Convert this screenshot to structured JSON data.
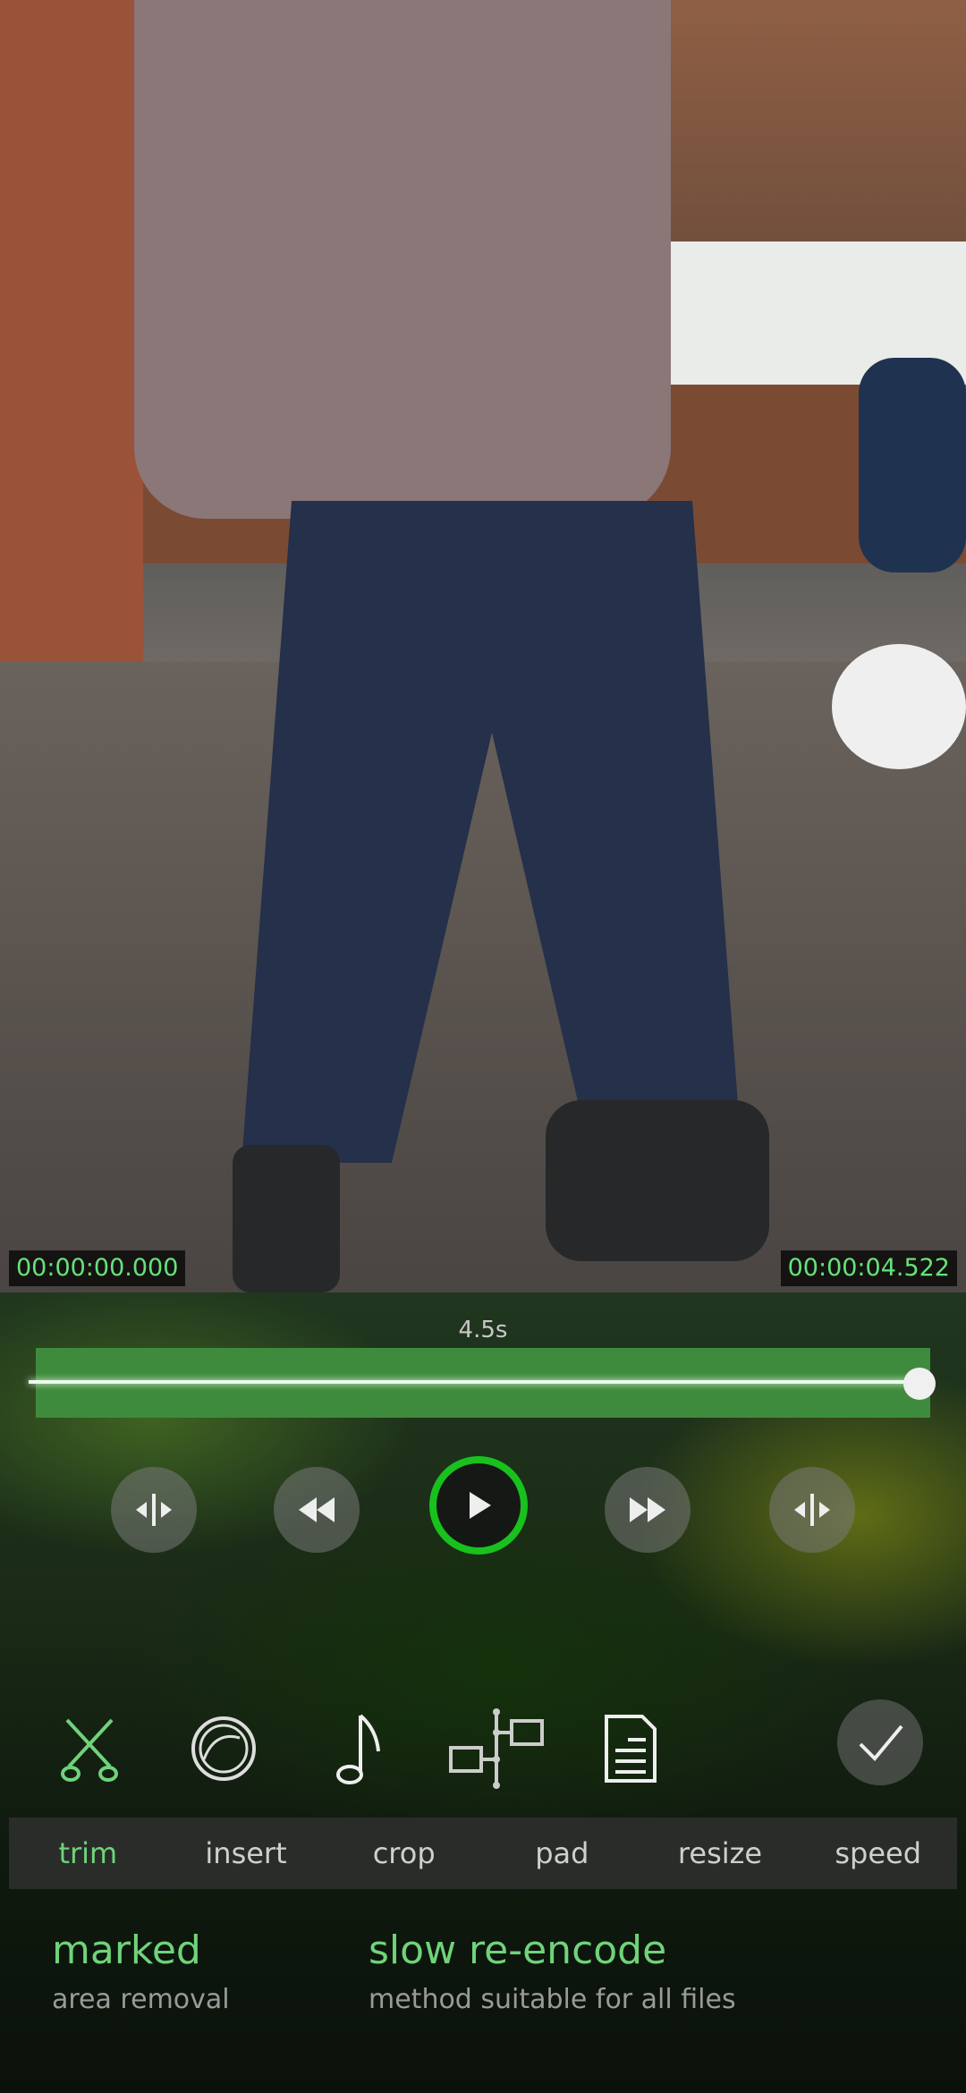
{
  "video": {
    "start_time": "00:00:00.000",
    "end_time": "00:00:04.522"
  },
  "timeline": {
    "duration": "4.5s",
    "position_fraction": 1.0
  },
  "playback_controls": [
    {
      "name": "split-left",
      "icon": "split-icon"
    },
    {
      "name": "rewind",
      "icon": "rewind-icon"
    },
    {
      "name": "play",
      "icon": "play-icon"
    },
    {
      "name": "fast-forward",
      "icon": "fast-forward-icon"
    },
    {
      "name": "split-right",
      "icon": "split-icon"
    }
  ],
  "tools": [
    {
      "name": "trim",
      "icon": "scissors-icon",
      "active": true
    },
    {
      "name": "filter",
      "icon": "filter-icon"
    },
    {
      "name": "audio",
      "icon": "music-note-icon"
    },
    {
      "name": "transition",
      "icon": "split-frames-icon"
    },
    {
      "name": "document",
      "icon": "document-icon"
    }
  ],
  "tabs": [
    {
      "label": "trim",
      "active": true
    },
    {
      "label": "insert"
    },
    {
      "label": "crop"
    },
    {
      "label": "pad"
    },
    {
      "label": "resize"
    },
    {
      "label": "speed"
    }
  ],
  "info": {
    "mode_title": "marked",
    "mode_subtitle": "area removal",
    "method_title": "slow re-encode",
    "method_subtitle": "method suitable for all files"
  },
  "colors": {
    "accent": "#18c11e",
    "active_text": "#6fd37a",
    "timecode_text": "#66e27a",
    "timeline_track": "#3f8b3d"
  }
}
